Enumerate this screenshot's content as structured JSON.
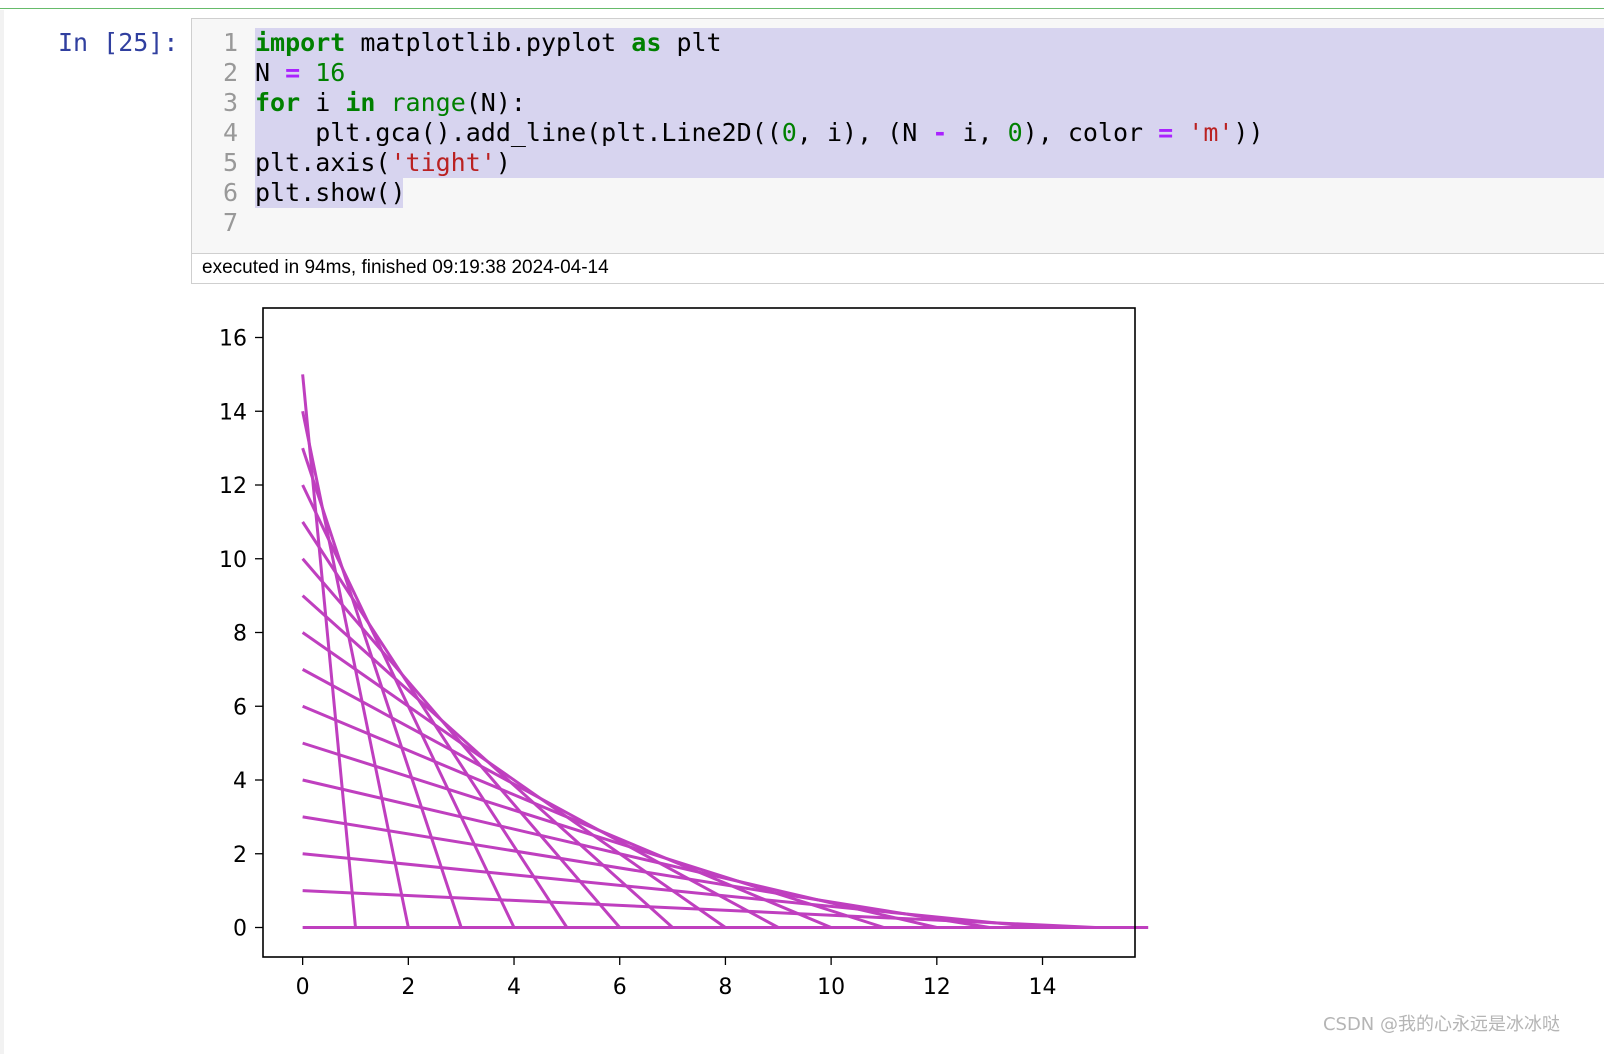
{
  "cell": {
    "prompt": "In [25]:",
    "lines": [
      {
        "n": "1",
        "tokens": [
          [
            "kw",
            "import"
          ],
          [
            "",
            " matplotlib.pyplot "
          ],
          [
            "kw",
            "as"
          ],
          [
            "",
            " plt"
          ]
        ],
        "hl": true
      },
      {
        "n": "2",
        "tokens": [
          [
            "",
            "N "
          ],
          [
            "op",
            "="
          ],
          [
            "num",
            " 16"
          ]
        ],
        "hl": true
      },
      {
        "n": "3",
        "tokens": [
          [
            "kw",
            "for"
          ],
          [
            "",
            " i "
          ],
          [
            "kw",
            "in"
          ],
          [
            "",
            " "
          ],
          [
            "bi",
            "range"
          ],
          [
            "",
            "(N):"
          ]
        ],
        "hl": true
      },
      {
        "n": "4",
        "tokens": [
          [
            "",
            "    plt.gca().add_line(plt.Line2D(("
          ],
          [
            "num",
            "0"
          ],
          [
            "",
            ", i), (N "
          ],
          [
            "op",
            "-"
          ],
          [
            "",
            " i, "
          ],
          [
            "num",
            "0"
          ],
          [
            "",
            "), color "
          ],
          [
            "op",
            "="
          ],
          [
            "",
            " "
          ],
          [
            "str",
            "'m'"
          ],
          [
            "",
            "))"
          ]
        ],
        "hl": true
      },
      {
        "n": "5",
        "tokens": [
          [
            "",
            "plt.axis("
          ],
          [
            "str",
            "'tight'"
          ],
          [
            "",
            ")"
          ]
        ],
        "hl": true
      },
      {
        "n": "6",
        "tokens": [
          [
            "",
            "plt.show()"
          ]
        ],
        "hl": "partial"
      },
      {
        "n": "7",
        "tokens": [],
        "hl": false
      }
    ],
    "status": "executed in 94ms, finished 09:19:38 2024-04-14"
  },
  "chart_data": {
    "type": "line",
    "N": 16,
    "segments_description": "lines from (0, i) to (N - i, 0) for i in range(N)",
    "series_color": "#bf3fbf",
    "xticks": [
      "0",
      "2",
      "4",
      "6",
      "8",
      "10",
      "12",
      "14"
    ],
    "yticks": [
      "0",
      "2",
      "4",
      "6",
      "8",
      "10",
      "12",
      "14",
      "16"
    ],
    "xlim": [
      -0.75,
      15.75
    ],
    "ylim": [
      -0.8,
      16.8
    ],
    "grid": false
  },
  "watermark": "CSDN @我的心永远是冰冰哒"
}
